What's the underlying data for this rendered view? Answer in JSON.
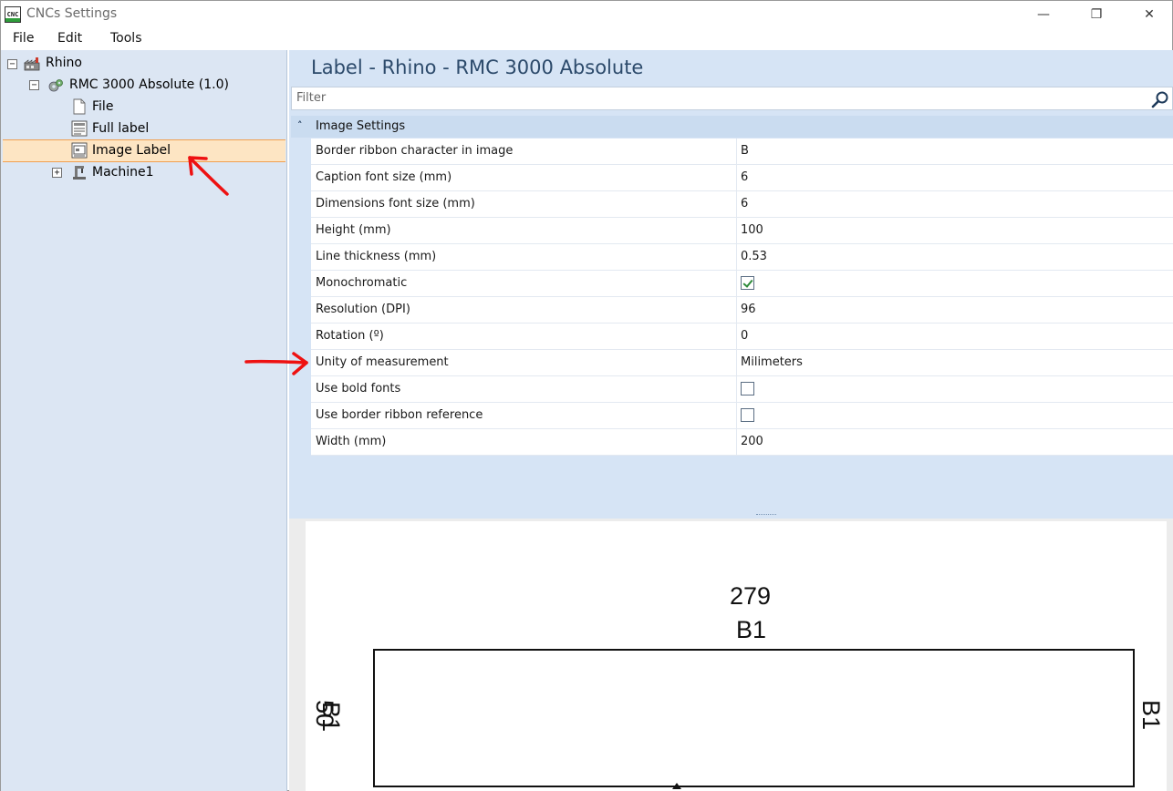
{
  "window": {
    "title": "CNCs Settings",
    "icon_text": "CNC",
    "controls": {
      "minimize": "—",
      "maximize": "❐",
      "close": "✕"
    }
  },
  "menu": [
    {
      "label": "File"
    },
    {
      "label": "Edit"
    },
    {
      "label": "Tools"
    }
  ],
  "tree": {
    "root": {
      "label": "Rhino",
      "expander": "−",
      "icon": "factory-icon"
    },
    "machine": {
      "label": "RMC 3000 Absolute (1.0)",
      "expander": "−",
      "icon": "gears-icon"
    },
    "children": [
      {
        "label": "File",
        "icon": "file-icon"
      },
      {
        "label": "Full label",
        "icon": "full-label-icon"
      },
      {
        "label": "Image Label",
        "icon": "image-label-icon",
        "selected": true
      }
    ],
    "machine1": {
      "label": "Machine1",
      "expander": "+",
      "icon": "machine-icon"
    }
  },
  "panel": {
    "title": "Label - Rhino - RMC 3000 Absolute",
    "filter_placeholder": "Filter",
    "category": {
      "label": "Image Settings",
      "chevron": "˄"
    },
    "properties": [
      {
        "name": "Border ribbon character in image",
        "value": "B",
        "type": "text"
      },
      {
        "name": "Caption font size (mm)",
        "value": "6",
        "type": "text"
      },
      {
        "name": "Dimensions font size (mm)",
        "value": "6",
        "type": "text"
      },
      {
        "name": "Height (mm)",
        "value": "100",
        "type": "text"
      },
      {
        "name": "Line thickness (mm)",
        "value": "0.53",
        "type": "text"
      },
      {
        "name": "Monochromatic",
        "value": true,
        "type": "checkbox"
      },
      {
        "name": "Resolution (DPI)",
        "value": "96",
        "type": "text"
      },
      {
        "name": "Rotation (º)",
        "value": "0",
        "type": "text"
      },
      {
        "name": "Unity of measurement",
        "value": "Milimeters",
        "type": "text"
      },
      {
        "name": "Use bold fonts",
        "value": false,
        "type": "checkbox"
      },
      {
        "name": "Use border ribbon reference",
        "value": false,
        "type": "checkbox"
      },
      {
        "name": "Width (mm)",
        "value": "200",
        "type": "text"
      }
    ]
  },
  "preview": {
    "top_dimension": "279",
    "top_ribbon": "B1",
    "left_dimension": "50",
    "left_ribbon": "B1",
    "right_ribbon": "B1"
  },
  "colors": {
    "tree_bg": "#dce6f3",
    "panel_bg": "#d6e4f5",
    "selection": "#fde5c3",
    "annotation_arrow": "#ee1111",
    "title_text": "#2c4a6b"
  }
}
